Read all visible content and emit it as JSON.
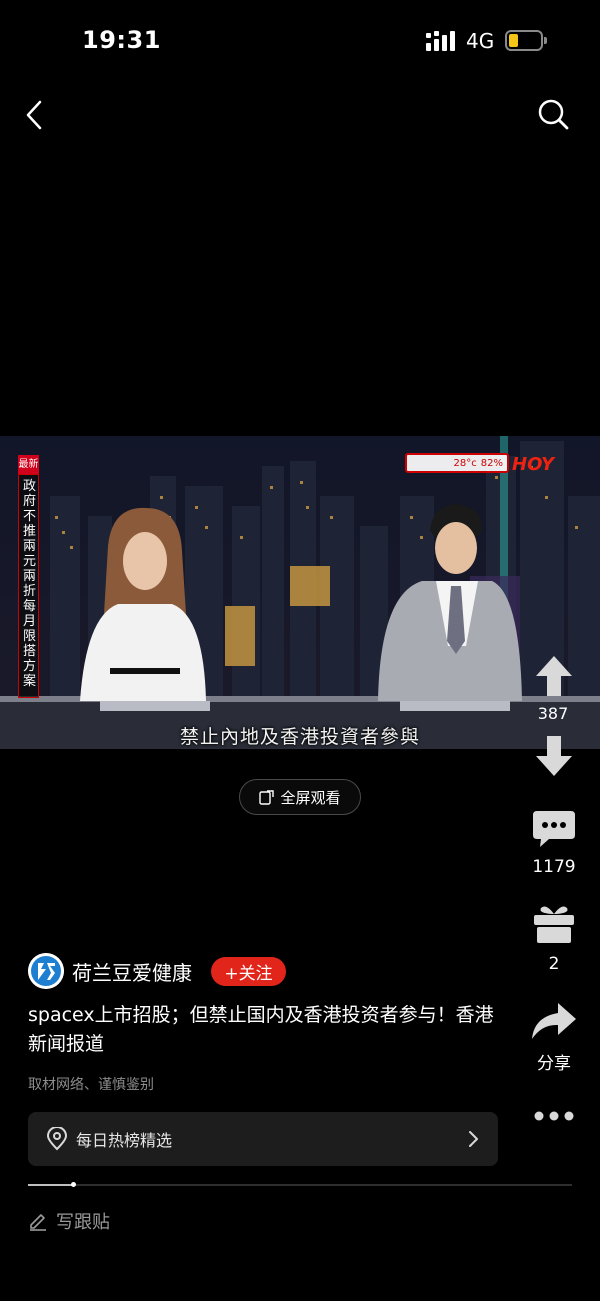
{
  "status_bar": {
    "time": "19:31",
    "network": "4G",
    "battery_level": 0.3,
    "battery_color": "#f5c518"
  },
  "nav": {
    "back_icon": "chevron-left-icon",
    "search_icon": "search-icon"
  },
  "video": {
    "subtitle": "禁止內地及香港投資者參與",
    "news_tag": "最新",
    "news_vertical": "政府不推兩元兩折每月限搭方案",
    "weather_temp": "28°c",
    "weather_humidity": "82%",
    "tv_logo": "HOY"
  },
  "fullscreen": {
    "label": "全屏观看"
  },
  "actions": {
    "vote_count": "387",
    "comment_count": "1179",
    "gift_count": "2",
    "share_label": "分享"
  },
  "author": {
    "name": "荷兰豆爱健康",
    "follow_label": "+关注"
  },
  "post": {
    "title": "spacex上市招股；但禁止国内及香港投资者参与！香港新闻报道",
    "disclaimer": "取材网络、谨慎鉴别"
  },
  "topic": {
    "label": "每日热榜精选"
  },
  "progress": {
    "fraction": 0.082
  },
  "footer": {
    "write_label": "写跟贴"
  },
  "colors": {
    "accent_red": "#e1251b",
    "background": "#000000",
    "topic_bg": "#1d1d1d"
  }
}
